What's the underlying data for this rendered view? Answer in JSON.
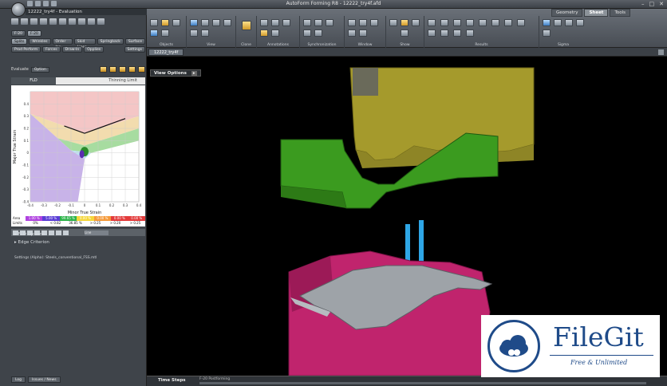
{
  "window": {
    "title": "AutoForm Forming R8 - 12222_try4f.afd",
    "controls": [
      "–",
      "□",
      "✕"
    ]
  },
  "left_panel": {
    "file_label": "12222_try4f - Evaluation",
    "tool_pills_row1": [
      "F-20",
      "F-20"
    ],
    "tool_pills_row2": [
      "Splits",
      "Wrinkles",
      "Order Ins",
      "Skid Lines",
      "Springback",
      "Surface"
    ],
    "tool_pills_row3": [
      "Prod Perform",
      "Forces",
      "Draw-In",
      "Opplies",
      "Settings"
    ],
    "evaluate_label": "Evaluate",
    "evaluate_select": "Option",
    "subtabs": [
      "FLD",
      "",
      "Thinning Limit"
    ],
    "legend": {
      "row1": [
        "Area",
        "1.00 %",
        "5.00 %",
        "99.65 %",
        "0.00 %",
        "0.00 %",
        "0.00 %",
        "0.00 %"
      ],
      "row2": [
        "Limits",
        "0%",
        "< 0.82",
        "36.85 %",
        "> 0.25",
        "> 0.20",
        "> 0.25"
      ]
    },
    "tree": [
      "FLD Options",
      "Edge Criterion"
    ],
    "settings_text": "Settings (Alpha): Steels_conventional_FSS.mtl",
    "bottom_tabs": [
      "Log",
      "Issues / News"
    ],
    "tool_select": "Line"
  },
  "ribbon": {
    "tabs": [
      "Geometry",
      "Sheet",
      "Tools"
    ],
    "active_tab": "Sheet",
    "groups": [
      "Objects",
      "View",
      "Clone",
      "Annotations",
      "Synchronization",
      "Window",
      "Show",
      "Results",
      "Sigma"
    ]
  },
  "document": {
    "tab_label": "12222_try4f"
  },
  "viewport": {
    "view_options_label": "View Options",
    "time_steps_label": "Time Steps",
    "step_name": "F-20 Postforming"
  },
  "chart_data": {
    "type": "scatter",
    "xlabel": "Minor True Strain",
    "ylabel": "Major True Strain",
    "xlim": [
      -0.4,
      0.4
    ],
    "ylim": [
      -0.4,
      0.5
    ],
    "x_ticks": [
      "-0.4",
      "-0.3",
      "-0.2",
      "-0.1",
      "0",
      "0.1",
      "0.2",
      "0.3",
      "0.4"
    ],
    "y_ticks": [
      "0.4",
      "0.3",
      "0.2",
      "0.1",
      "0",
      "-0.1",
      "-0.2",
      "-0.3",
      "-0.4"
    ],
    "flc": {
      "x": [
        -0.15,
        -0.05,
        0.0,
        0.1,
        0.2,
        0.3
      ],
      "y": [
        0.22,
        0.18,
        0.16,
        0.2,
        0.24,
        0.28
      ]
    },
    "region_colors": {
      "split": "#f4c6c6",
      "risk": "#f2dcae",
      "safe": "#a7dca0",
      "thinning": "#bfe2f2",
      "compress": "#c8b3e8",
      "points": "#2a8a2a"
    }
  },
  "watermark": {
    "brand": "FileGit",
    "tagline": "Free & Unlimited",
    "color": "#1f4b89"
  }
}
